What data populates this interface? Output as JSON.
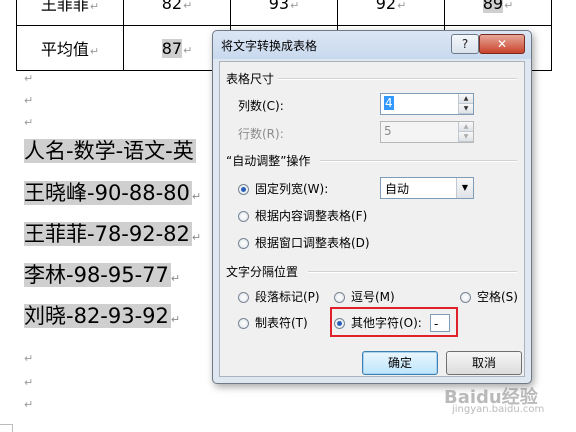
{
  "document": {
    "table_rows": [
      {
        "name": "王菲菲",
        "math": "82",
        "chinese": "93",
        "english": "92",
        "total": "89"
      },
      {
        "name": "平均值",
        "math": "87",
        "chinese": "",
        "english": "",
        "total": ""
      }
    ],
    "para_mark": "↵",
    "lines": [
      "人名-数学-语文-英",
      "王晓峰-90-88-80",
      "王菲菲-78-92-82",
      "李林-98-95-77",
      "刘晓-82-93-92"
    ]
  },
  "dialog": {
    "title": "将文字转换成表格",
    "help_label": "?",
    "close_label": "✕",
    "table_size": {
      "group_label": "表格尺寸",
      "columns_label": "列数(C):",
      "columns_value": "4",
      "rows_label": "行数(R):",
      "rows_value": "5"
    },
    "autofit": {
      "group_label": "“自动调整”操作",
      "fixed_width_label": "固定列宽(W):",
      "fixed_width_value": "自动",
      "content_label": "根据内容调整表格(F)",
      "window_label": "根据窗口调整表格(D)",
      "selected": "fixed"
    },
    "separator": {
      "group_label": "文字分隔位置",
      "paragraph_label": "段落标记(P)",
      "comma_label": "逗号(M)",
      "space_label": "空格(S)",
      "tab_label": "制表符(T)",
      "other_label": "其他字符(O):",
      "other_value": "-",
      "selected": "other"
    },
    "ok_label": "确定",
    "cancel_label": "取消"
  },
  "watermark": {
    "main": "Baidu经验",
    "sub": "jingyan.baidu.com"
  },
  "colors": {
    "highlight_box": "#e0202a",
    "selection": "#cfcfcf"
  }
}
